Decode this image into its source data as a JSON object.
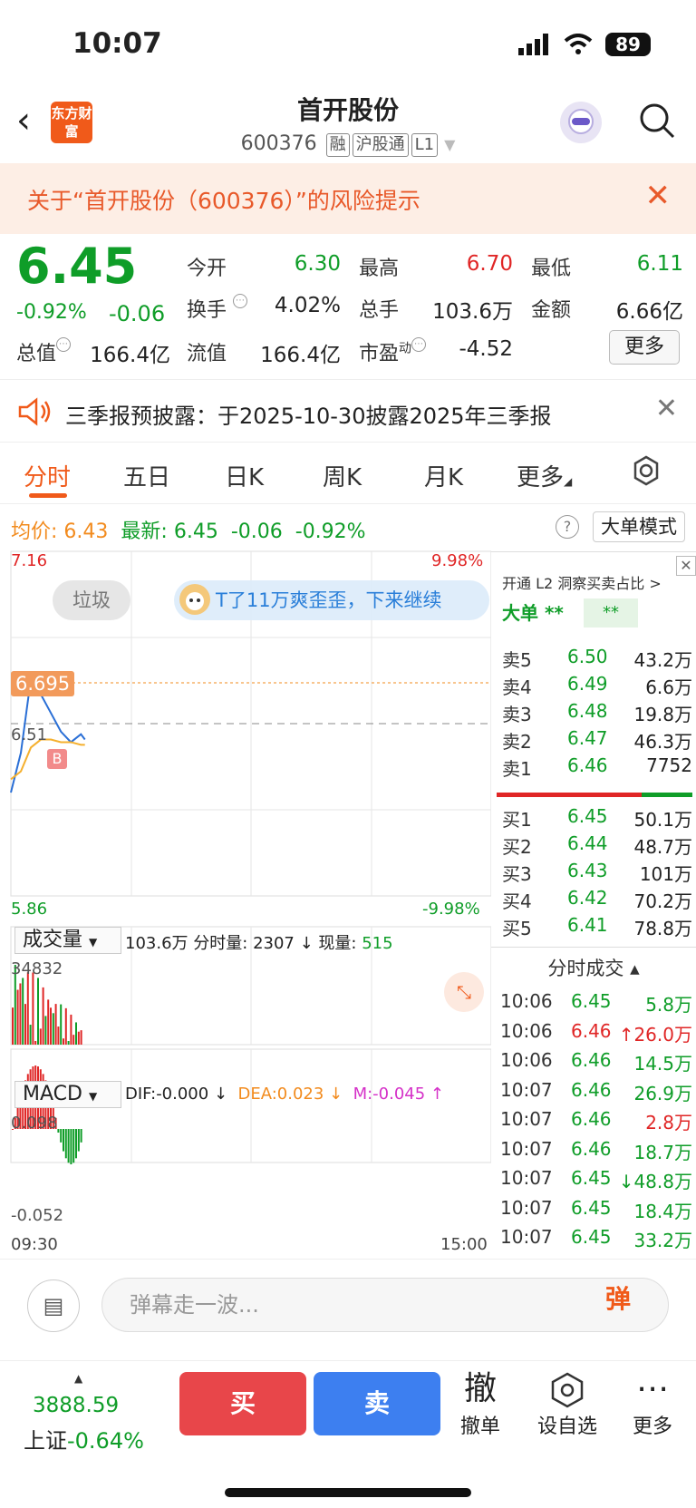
{
  "status": {
    "time": "10:07",
    "battery": "89"
  },
  "header": {
    "title": "首开股份",
    "code": "600376",
    "tags": [
      "融",
      "沪股通",
      "L1"
    ],
    "logo_text": "东方财富"
  },
  "risk_banner": {
    "text": "关于“首开股份（600376）”的风险提示"
  },
  "quote": {
    "price": "6.45",
    "change_pct": "-0.92%",
    "change": "-0.06",
    "open_label": "今开",
    "open": "6.30",
    "high_label": "最高",
    "high": "6.70",
    "low_label": "最低",
    "low": "6.11",
    "turnover_label": "换手",
    "turnover": "4.02%",
    "volume_label": "总手",
    "volume": "103.6万",
    "amount_label": "金额",
    "amount": "6.66亿",
    "mktcap_label": "总值",
    "mktcap": "166.4亿",
    "float_label": "流值",
    "float": "166.4亿",
    "pe_label": "市盈",
    "pe_sup": "动",
    "pe": "-4.52",
    "more": "更多"
  },
  "notice": {
    "text": "三季报预披露：于2025-10-30披露2025年三季报"
  },
  "tabs": [
    "分时",
    "五日",
    "日K",
    "周K",
    "月K",
    "更多"
  ],
  "intraday": {
    "avg_label": "均价:",
    "avg": "6.43",
    "last_label": "最新:",
    "last": "6.45",
    "chg": "-0.06",
    "pct": "-0.92%",
    "bigorder_btn": "大单模式",
    "y_top": "7.16",
    "y_top_pct": "9.98%",
    "y_bottom": "5.86",
    "y_bottom_pct": "-9.98%",
    "price_tag": "6.695",
    "mid_label": "6.51",
    "b_marker": "B",
    "trash_label": "垃圾",
    "comment": "T了11万爽歪歪，下来继续",
    "time_start": "09:30",
    "time_end": "15:00"
  },
  "volume": {
    "label": "成交量",
    "total": "103.6万",
    "fs_label": "分时量:",
    "fs": "2307",
    "now_label": "现量:",
    "now": "515",
    "max": "34832"
  },
  "macd": {
    "label": "MACD",
    "dif": "DIF:-0.000",
    "dea": "DEA:0.023",
    "m": "M:-0.045",
    "top": "0.098",
    "bottom": "-0.052"
  },
  "chart_data": {
    "type": "line",
    "x": [
      "09:30",
      "09:35",
      "09:40",
      "09:45",
      "09:50",
      "09:55",
      "10:00",
      "10:05",
      "10:07"
    ],
    "series": [
      {
        "values": [
          6.25,
          6.4,
          6.68,
          6.62,
          6.55,
          6.48,
          6.44,
          6.47,
          6.45
        ]
      },
      {
        "values": [
          6.3,
          6.33,
          6.42,
          6.45,
          6.45,
          6.44,
          6.44,
          6.43,
          6.43
        ]
      }
    ],
    "ylim": [
      5.86,
      7.16
    ]
  },
  "orderbook": {
    "head": "开通 L2 洞察买卖占比 >",
    "big_label": "大单 **",
    "big_box": "**",
    "asks": [
      {
        "label": "卖5",
        "price": "6.50",
        "vol": "43.2万"
      },
      {
        "label": "卖4",
        "price": "6.49",
        "vol": "6.6万"
      },
      {
        "label": "卖3",
        "price": "6.48",
        "vol": "19.8万"
      },
      {
        "label": "卖2",
        "price": "6.47",
        "vol": "46.3万"
      },
      {
        "label": "卖1",
        "price": "6.46",
        "vol": "7752"
      }
    ],
    "bids": [
      {
        "label": "买1",
        "price": "6.45",
        "vol": "50.1万"
      },
      {
        "label": "买2",
        "price": "6.44",
        "vol": "48.7万"
      },
      {
        "label": "买3",
        "price": "6.43",
        "vol": "101万"
      },
      {
        "label": "买4",
        "price": "6.42",
        "vol": "70.2万"
      },
      {
        "label": "买5",
        "price": "6.41",
        "vol": "78.8万"
      }
    ]
  },
  "ticks": {
    "head": "分时成交 ▴",
    "rows": [
      {
        "time": "10:06",
        "price": "6.45",
        "vol": "5.8万",
        "c": "green",
        "vc": "green"
      },
      {
        "time": "10:06",
        "price": "6.46",
        "vol": "↑26.0万",
        "c": "red",
        "vc": "red"
      },
      {
        "time": "10:06",
        "price": "6.46",
        "vol": "14.5万",
        "c": "green",
        "vc": "green"
      },
      {
        "time": "10:07",
        "price": "6.46",
        "vol": "26.9万",
        "c": "green",
        "vc": "green"
      },
      {
        "time": "10:07",
        "price": "6.46",
        "vol": "2.8万",
        "c": "green",
        "vc": "red"
      },
      {
        "time": "10:07",
        "price": "6.46",
        "vol": "18.7万",
        "c": "green",
        "vc": "green"
      },
      {
        "time": "10:07",
        "price": "6.45",
        "vol": "↓48.8万",
        "c": "green",
        "vc": "green"
      },
      {
        "time": "10:07",
        "price": "6.45",
        "vol": "18.4万",
        "c": "green",
        "vc": "green"
      },
      {
        "time": "10:07",
        "price": "6.45",
        "vol": "33.2万",
        "c": "green",
        "vc": "green"
      }
    ]
  },
  "comment_bar": {
    "placeholder": "弹幕走一波...",
    "danmu": "弹"
  },
  "bottom": {
    "index_value": "3888.59",
    "index_name": "上证",
    "index_pct": "-0.64%",
    "buy": "买",
    "sell": "卖",
    "cancel_icon": "撤",
    "cancel": "撤单",
    "fav": "设自选",
    "more": "更多"
  }
}
